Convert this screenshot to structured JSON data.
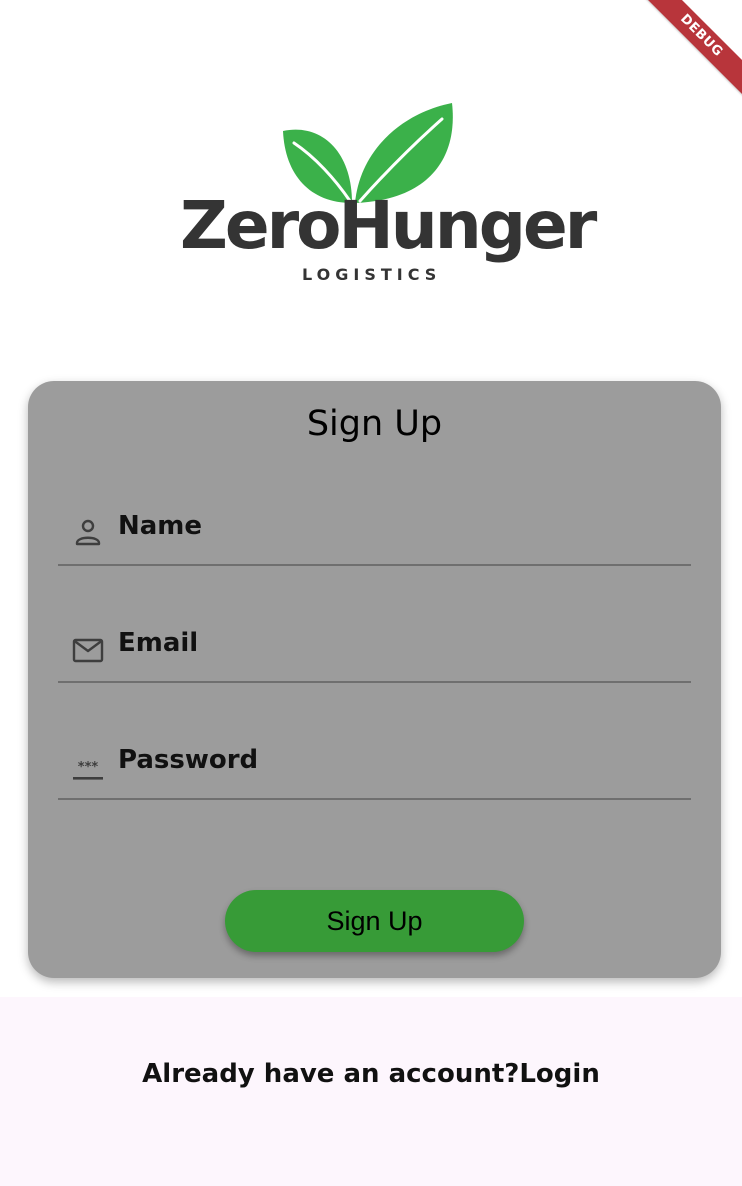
{
  "debug_banner": "DEBUG",
  "logo": {
    "wordmark": "ZeroHunger",
    "subtitle": "LOGISTICS",
    "leaf_color": "#3bb14a",
    "text_color": "#343434"
  },
  "form": {
    "title": "Sign Up",
    "fields": [
      {
        "label": "Name",
        "icon": "person-icon"
      },
      {
        "label": "Email",
        "icon": "mail-icon"
      },
      {
        "label": "Password",
        "icon": "password-icon"
      }
    ],
    "submit_label": "Sign Up",
    "card_color": "#9c9c9c",
    "button_color": "#379b37"
  },
  "footer": {
    "prompt": "Already have an account?",
    "link": "Login"
  }
}
